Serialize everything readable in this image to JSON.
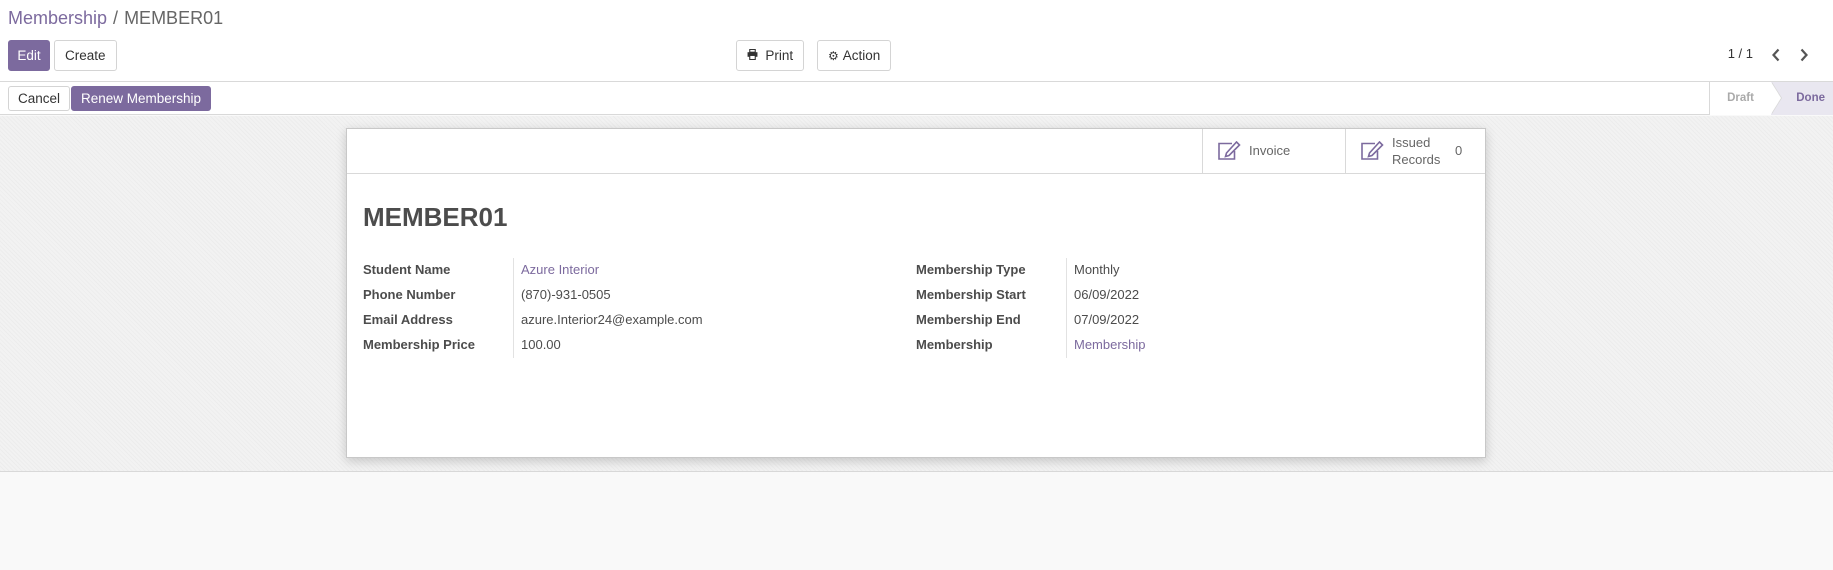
{
  "breadcrumb": {
    "parent": "Membership",
    "separator": "/",
    "current": "MEMBER01"
  },
  "toolbar": {
    "edit_label": "Edit",
    "create_label": "Create",
    "print_label": "Print",
    "action_label": "Action"
  },
  "pager": {
    "value": "1 / 1"
  },
  "statusbar": {
    "cancel_label": "Cancel",
    "renew_label": "Renew Membership",
    "steps": [
      "Draft",
      "Done"
    ],
    "active_step": "Done"
  },
  "smart_buttons": {
    "invoice_label": "Invoice",
    "issued_label_line1": "Issued",
    "issued_label_line2": "Records",
    "issued_count": "0"
  },
  "record": {
    "name": "MEMBER01",
    "left_fields": [
      {
        "label": "Student Name",
        "value": "Azure Interior"
      },
      {
        "label": "Phone Number",
        "value": "(870)-931-0505"
      },
      {
        "label": "Email Address",
        "value": "azure.Interior24@example.com"
      },
      {
        "label": "Membership Price",
        "value": "100.00"
      }
    ],
    "right_fields": [
      {
        "label": "Membership Type",
        "value": "Monthly"
      },
      {
        "label": "Membership Start",
        "value": "06/09/2022"
      },
      {
        "label": "Membership End",
        "value": "07/09/2022"
      },
      {
        "label": "Membership",
        "value": "Membership"
      }
    ]
  },
  "colors": {
    "primary": "#7c6a9e",
    "text": "#4c4c4c"
  }
}
